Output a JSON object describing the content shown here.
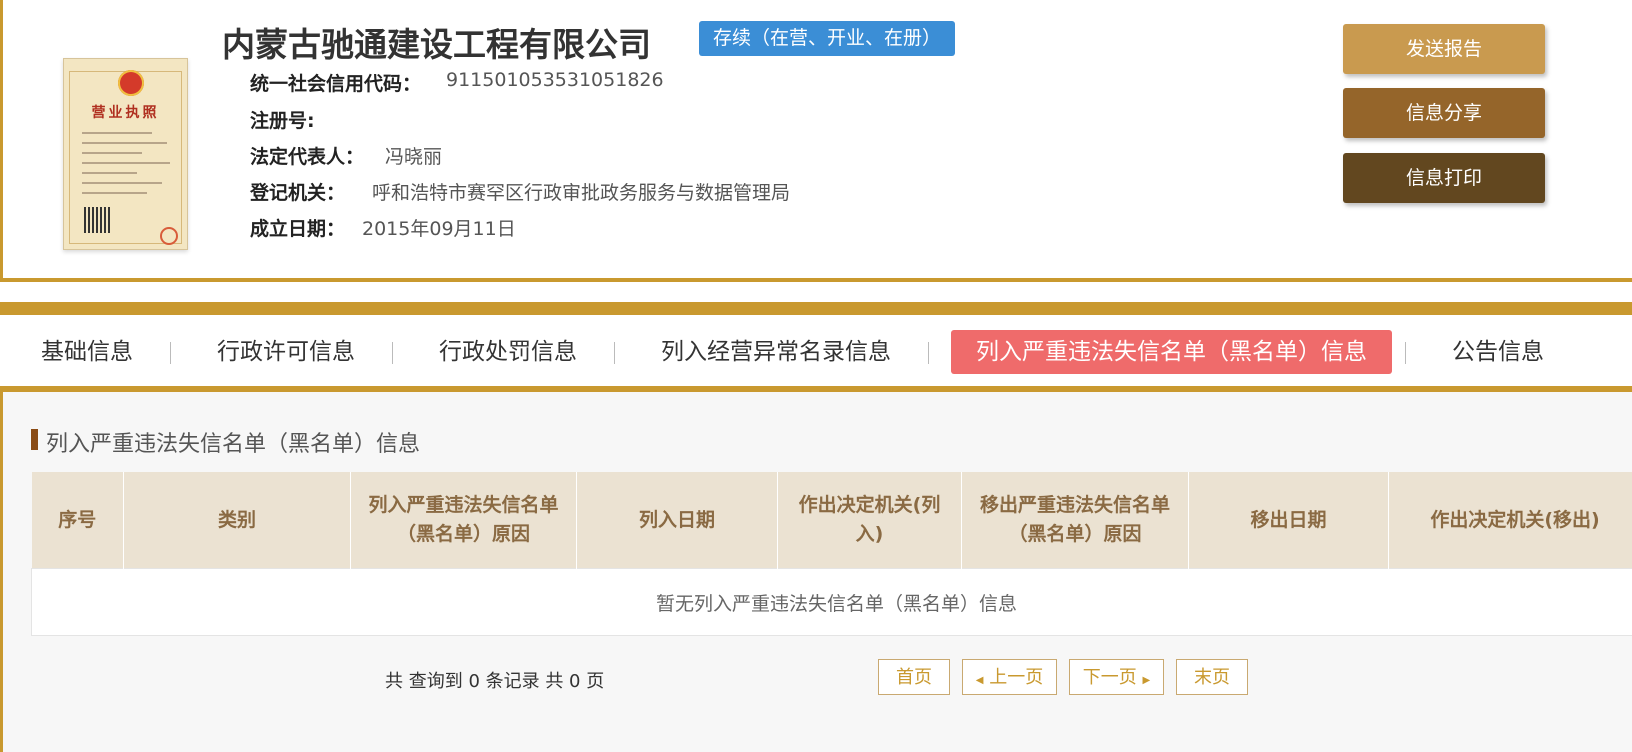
{
  "company": {
    "name": "内蒙古驰通建设工程有限公司",
    "status": "存续（在营、开业、在册）",
    "license_title": "营业执照"
  },
  "info": {
    "credit_code_label": "统一社会信用代码：",
    "credit_code": "911501053531051826",
    "reg_no_label": "注册号:",
    "reg_no": "",
    "legal_rep_label": "法定代表人：",
    "legal_rep": "冯晓丽",
    "authority_label": "登记机关：",
    "authority": "呼和浩特市赛罕区行政审批政务服务与数据管理局",
    "founded_label": "成立日期：",
    "founded": "2015年09月11日"
  },
  "actions": {
    "send_report": "发送报告",
    "share": "信息分享",
    "print": "信息打印"
  },
  "tabs": [
    {
      "label": "基础信息"
    },
    {
      "label": "行政许可信息"
    },
    {
      "label": "行政处罚信息"
    },
    {
      "label": "列入经营异常名录信息"
    },
    {
      "label": "列入严重违法失信名单（黑名单）信息"
    },
    {
      "label": "公告信息"
    }
  ],
  "section": {
    "title": "列入严重违法失信名单（黑名单）信息"
  },
  "table": {
    "columns": [
      "序号",
      "类别",
      "列入严重违法失信名单（黑名单）原因",
      "列入日期",
      "作出决定机关(列入)",
      "移出严重违法失信名单（黑名单）原因",
      "移出日期",
      "作出决定机关(移出)"
    ],
    "empty_text": "暂无列入严重违法失信名单（黑名单）信息"
  },
  "pager": {
    "summary": "共 查询到 0 条记录 共 0 页",
    "first": "首页",
    "prev": "上一页",
    "next": "下一页",
    "last": "末页"
  },
  "colors": {
    "gold": "#c9992f",
    "status_blue": "#3b8ed6",
    "active_tab": "#ef6b6b",
    "btn_send": "#c99a4f",
    "btn_share": "#95652a",
    "btn_print": "#62471f"
  }
}
